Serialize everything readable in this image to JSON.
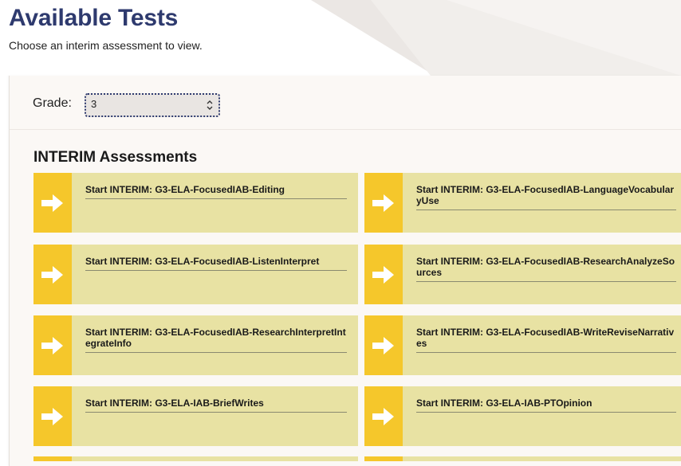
{
  "header": {
    "title": "Available Tests",
    "subtitle": "Choose an interim assessment to view."
  },
  "grade": {
    "label": "Grade:",
    "selected": "3"
  },
  "section": {
    "title": "INTERIM Assessments"
  },
  "tests": [
    {
      "label": "Start INTERIM: G3-ELA-FocusedIAB-Editing"
    },
    {
      "label": "Start INTERIM: G3-ELA-FocusedIAB-LanguageVocabularyUse"
    },
    {
      "label": "Start INTERIM: G3-ELA-FocusedIAB-ListenInterpret"
    },
    {
      "label": "Start INTERIM: G3-ELA-FocusedIAB-ResearchAnalyzeSources"
    },
    {
      "label": "Start INTERIM: G3-ELA-FocusedIAB-ResearchInterpretIntegrateInfo"
    },
    {
      "label": "Start INTERIM: G3-ELA-FocusedIAB-WriteReviseNarratives"
    },
    {
      "label": "Start INTERIM: G3-ELA-IAB-BriefWrites"
    },
    {
      "label": "Start INTERIM: G3-ELA-IAB-PTOpinion"
    }
  ],
  "icons": {
    "start": "arrow-right-icon",
    "select": "chevron-updown-icon"
  },
  "colors": {
    "title": "#2e3a6e",
    "card_background": "#e8e2a3",
    "arrow_background": "#f5c72b"
  }
}
